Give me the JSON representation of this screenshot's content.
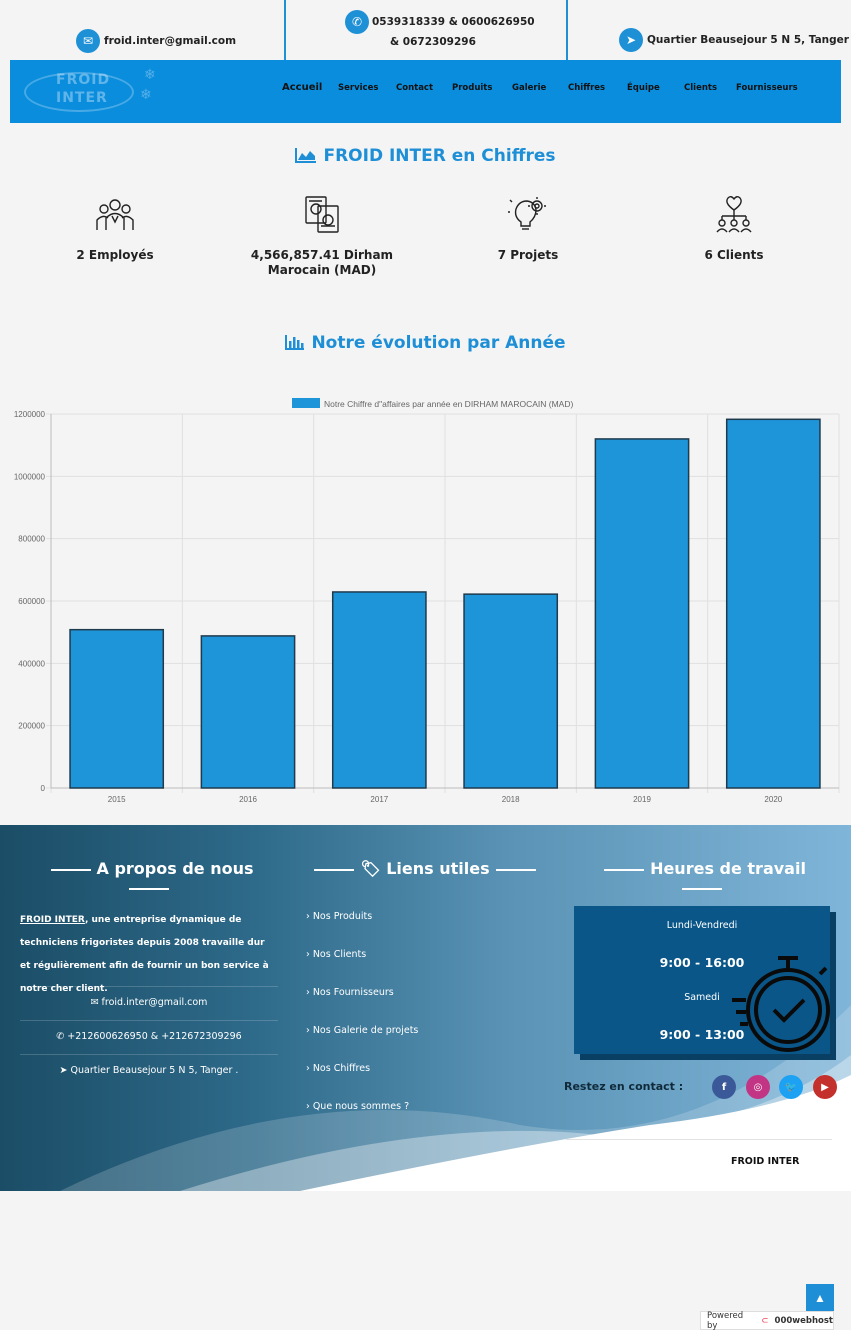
{
  "topbar": {
    "email": "froid.inter@gmail.com",
    "phone_line1": "0539318339 & 0600626950",
    "phone_line2": "& 0672309296",
    "address": "Quartier Beausejour 5 N 5, Tanger"
  },
  "logo": {
    "line1": "FROID",
    "line2": "INTER"
  },
  "nav": {
    "items": [
      "Accueil",
      "Services",
      "Contact",
      "Produits",
      "Galerie",
      "Chiffres",
      "Équipe",
      "Clients",
      "Fournisseurs"
    ]
  },
  "figures": {
    "title": "FROID INTER en Chiffres",
    "stats": [
      {
        "label": "2 Employés",
        "icon": "team-icon"
      },
      {
        "label": "4,566,857.41 Dirham Marocain (MAD)",
        "icon": "money-document-icon"
      },
      {
        "label": "7 Projets",
        "icon": "idea-gear-icon"
      },
      {
        "label": "6 Clients",
        "icon": "handshake-network-icon"
      }
    ]
  },
  "evolution": {
    "title": "Notre évolution par Année"
  },
  "chart_data": {
    "type": "bar",
    "categories": [
      "2015",
      "2016",
      "2017",
      "2018",
      "2019",
      "2020"
    ],
    "series": [
      {
        "name": "Notre Chiffre d\"affaires par année en DIRHAM MAROCAIN (MAD)",
        "values": [
          508000,
          488000,
          629000,
          622000,
          1120000,
          1183000
        ]
      }
    ],
    "ylim": [
      0,
      1200000
    ],
    "yticks": [
      "0",
      "200000",
      "400000",
      "600000",
      "800000",
      "1000000",
      "1200000"
    ],
    "legend": "top",
    "grid": true,
    "bar_color": "#1e95d9",
    "bar_border": "#1f3a4d"
  },
  "footer": {
    "about_title": "A propos de nous",
    "about_brand": "FROID INTER",
    "about_text": ", une entreprise dynamique de techniciens frigoristes depuis 2008 travaille dur et régulièrement afin de fournir un bon service à notre cher client.",
    "email": "froid.inter@gmail.com",
    "phones": "+212600626950 & +212672309296",
    "address": "Quartier Beausejour 5 N 5, Tanger .",
    "links_title": "Liens utiles",
    "links": [
      "Nos Produits",
      "Nos Clients",
      "Nos Fournisseurs",
      "Nos Galerie de projets",
      "Nos Chiffres",
      "Que nous sommes ?"
    ],
    "hours_title": "Heures de travail",
    "hours": [
      {
        "days": "Lundi-Vendredi",
        "time": "9:00 - 16:00"
      },
      {
        "days": "Samedi",
        "time": "9:00 - 13:00"
      }
    ],
    "stay_in_touch": "Restez en contact :",
    "copyright": "FROID INTER"
  },
  "powered": {
    "prefix": "Powered by",
    "brand": "000webhost"
  },
  "colors": {
    "accent": "#1e8fd6",
    "nav_bg": "#0a8ddd",
    "facebook": "#3b5998",
    "instagram": "#c13584",
    "twitter": "#1da1f2",
    "youtube": "#c4302b"
  }
}
